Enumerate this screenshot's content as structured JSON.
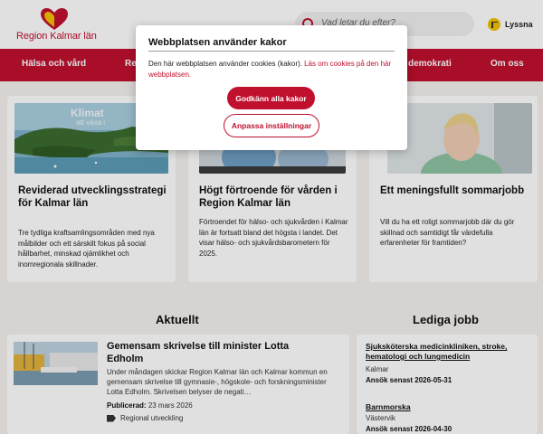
{
  "header": {
    "logo_text": "Region Kalmar län",
    "search_placeholder": "Vad letar du efter?",
    "listen_label": "Lyssna"
  },
  "nav": {
    "items": [
      "Hälsa och vård",
      "Re",
      "demokrati",
      "Om oss"
    ]
  },
  "cards": [
    {
      "image_label_1": "Klimat",
      "image_label_2": "att växa i",
      "title": "Reviderad utvecklingsstrategi för Kalmar län",
      "text": "Tre tydliga kraftsamlingsområden med nya målbilder och ett särskilt fokus på social hållbarhet, minskad ojämlikhet och inomregionala skillnader."
    },
    {
      "title": "Högt förtroende för vården i Region Kalmar län",
      "text": "Förtroendet för hälso- och sjukvården i Kalmar län är fortsatt bland det högsta i landet. Det visar hälso- och sjukvårdsbarometern för 2025."
    },
    {
      "title": "Ett meningsfullt sommarjobb",
      "text": "Vill du ha ett roligt sommarjobb där du gör skillnad och samtidigt får värdefulla erfarenheter för framtiden?"
    }
  ],
  "sections": {
    "news_heading": "Aktuellt",
    "jobs_heading": "Lediga jobb"
  },
  "news": {
    "title": "Gemensam skrivelse till minister Lotta Edholm",
    "text": "Under måndagen skickar Region Kalmar län och Kalmar kommun en gemensam skrivelse till gymnasie-, högskole- och forskningsminister Lotta Edholm. Skrivelsen belyser de negati…",
    "published_label": "Publicerad:",
    "published_date": "23 mars 2026",
    "tag": "Regional utveckling"
  },
  "jobs": [
    {
      "title": "Sjuksköterska medicinkliniken, stroke, hematologi och lungmedicin",
      "location": "Kalmar",
      "deadline": "Ansök senast 2026-05-31"
    },
    {
      "title": "Barnmorska",
      "location": "Västervik",
      "deadline": "Ansök senast 2026-04-30"
    }
  ],
  "cookie_modal": {
    "title": "Webbplatsen använder kakor",
    "text": "Den här webbplatsen använder cookies (kakor).",
    "link": "Läs om cookies på den här webbplatsen.",
    "accept_label": "Godkänn alla kakor",
    "customize_label": "Anpassa inställningar"
  },
  "colors": {
    "brand": "#c0102e",
    "accent_yellow": "#f2c200"
  }
}
